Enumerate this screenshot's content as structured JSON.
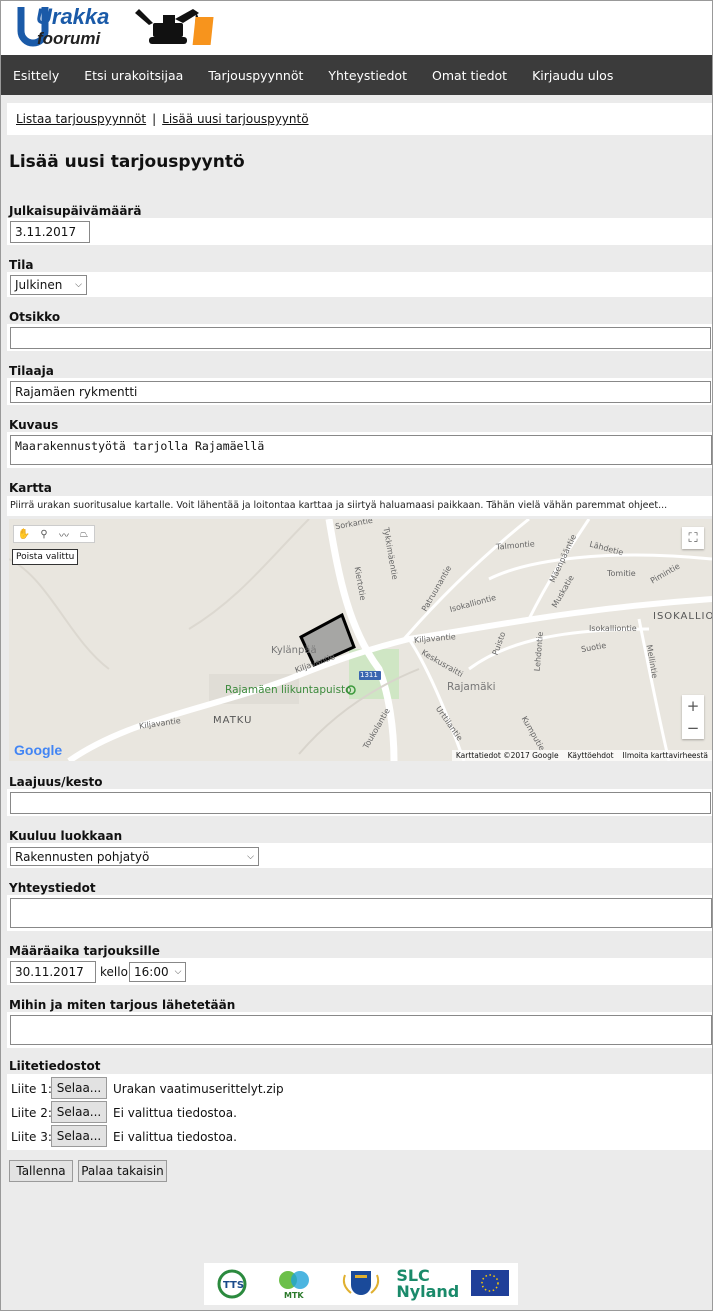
{
  "logo": {
    "line1": "Urakka",
    "line2": "foorumi"
  },
  "nav": {
    "items": [
      "Esittely",
      "Etsi urakoitsijaa",
      "Tarjouspyynnöt",
      "Yhteystiedot",
      "Omat tiedot",
      "Kirjaudu ulos"
    ]
  },
  "breadcrumb": {
    "list_link": "Listaa tarjouspyynnöt",
    "separator": "|",
    "add_link": "Lisää uusi tarjouspyyntö"
  },
  "page_title": "Lisää uusi tarjouspyyntö",
  "form": {
    "publish_date": {
      "label": "Julkaisupäivämäärä",
      "value": "3.11.2017"
    },
    "status": {
      "label": "Tila",
      "value": "Julkinen"
    },
    "title": {
      "label": "Otsikko",
      "value": ""
    },
    "client": {
      "label": "Tilaaja",
      "value": "Rajamäen rykmentti"
    },
    "description": {
      "label": "Kuvaus",
      "value": "Maarakennustyötä tarjolla Rajamäellä"
    },
    "map": {
      "label": "Kartta",
      "hint": "Piirrä urakan suoritusalue kartalle. Voit lähentää ja loitontaa karttaa ja siirtyä haluamaasi paikkaan. Tähän vielä vähän paremmat ohjeet...",
      "tooltip": "Poista valittu",
      "zoom_in": "+",
      "zoom_out": "−",
      "fullscreen_icon": "⛶",
      "google": "Google",
      "footer": [
        "Karttatiedot ©2017 Google",
        "Käyttöehdot",
        "Ilmoita karttavirheestä"
      ],
      "places": {
        "kylanpaa": "Kylänpää",
        "park": "Rajamäen liikuntapuisto",
        "matku": "MATKU",
        "rajamaki": "Rajamäki",
        "isokallio": "ISOKALLIO",
        "road_number": "1311",
        "streets": [
          "Kiljavantie",
          "Kiljavantie",
          "Kiljavantie",
          "Sorkantie",
          "Tykkimäentie",
          "Kiertotie",
          "Patruunantie",
          "Isokalliontie",
          "Talmontie",
          "Mäenpääntie",
          "Lähdetie",
          "Tomitie",
          "Pimintie",
          "Muskatie",
          "Isokalliontie",
          "Suotie",
          "Mellintie",
          "Lehdontie",
          "Puisto",
          "Keskusraitti",
          "Urttilantie",
          "Toukolantie",
          "Kumputie"
        ]
      }
    },
    "scope": {
      "label": "Laajuus/kesto",
      "value": ""
    },
    "category": {
      "label": "Kuuluu luokkaan",
      "value": "Rakennusten pohjatyö"
    },
    "contact": {
      "label": "Yhteystiedot",
      "value": ""
    },
    "deadline": {
      "label": "Määräaika tarjouksille",
      "date": "30.11.2017",
      "time_word": "kello",
      "time": "16:00"
    },
    "delivery": {
      "label": "Mihin ja miten tarjous lähetetään",
      "value": ""
    },
    "attachments": {
      "label": "Liitetiedostot",
      "browse": "Selaa...",
      "items": [
        {
          "label": "Liite 1:",
          "file": "Urakan vaatimuserittelyt.zip"
        },
        {
          "label": "Liite 2:",
          "file": "Ei valittua tiedostoa."
        },
        {
          "label": "Liite 3:",
          "file": "Ei valittua tiedostoa."
        }
      ]
    },
    "save_button": "Tallenna",
    "back_button": "Palaa takaisin"
  },
  "footer_logos": [
    "TTS",
    "MTK",
    "SLC Nyland"
  ],
  "colors": {
    "nav_bg": "#3b3b3b",
    "logo_blue": "#1a5aa8",
    "logo_orange": "#f7941d",
    "page_bg": "#ebebeb"
  }
}
